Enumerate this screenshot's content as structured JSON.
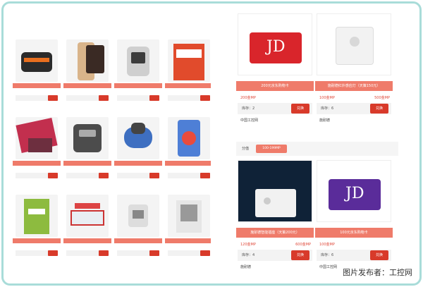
{
  "left_grid": {
    "items": [
      {
        "name": "",
        "price": "",
        "original": "",
        "stock": "",
        "button": "",
        "supplier": ""
      },
      {
        "name": "",
        "price": "",
        "original": "",
        "stock": "",
        "button": "",
        "supplier": ""
      },
      {
        "name": "",
        "price": "",
        "original": "",
        "stock": "",
        "button": "",
        "supplier": ""
      },
      {
        "name": "",
        "price": "",
        "original": "",
        "stock": "",
        "button": "",
        "supplier": ""
      },
      {
        "name": "",
        "price": "",
        "original": "",
        "stock": "",
        "button": "",
        "supplier": ""
      },
      {
        "name": "",
        "price": "",
        "original": "",
        "stock": "",
        "button": "",
        "supplier": ""
      },
      {
        "name": "",
        "price": "",
        "original": "",
        "stock": "",
        "button": "",
        "supplier": ""
      },
      {
        "name": "",
        "price": "",
        "original": "",
        "stock": "",
        "button": "",
        "supplier": ""
      },
      {
        "name": "",
        "price": "",
        "original": "",
        "stock": "",
        "button": "",
        "supplier": ""
      },
      {
        "name": "",
        "price": "",
        "original": "",
        "stock": "",
        "button": "",
        "supplier": ""
      },
      {
        "name": "",
        "price": "",
        "original": "",
        "stock": "",
        "button": "",
        "supplier": ""
      },
      {
        "name": "",
        "price": "",
        "original": "",
        "stock": "",
        "button": "",
        "supplier": ""
      }
    ]
  },
  "right_panel": {
    "top_cards": [
      {
        "name": "200元京东购物卡",
        "price": "200金MP",
        "original": "",
        "stock": "库存：2",
        "button": "兑换",
        "supplier": "中国工控网"
      },
      {
        "name": "施耐德红外感应灯（天策150元）",
        "price": "100金MP",
        "original": "500金MP",
        "stock": "库存：6",
        "button": "兑换",
        "supplier": "施耐德"
      }
    ],
    "filter": {
      "label": "分值",
      "chip": "100-199MP"
    },
    "bottom_cards": [
      {
        "name": "施耐德智能插座（天策200元）",
        "price": "120金MP",
        "original": "600金MP",
        "stock": "库存：4",
        "button": "兑换",
        "supplier": "施耐德"
      },
      {
        "name": "100元京东购物卡",
        "price": "100金MP",
        "original": "",
        "stock": "库存：6",
        "button": "兑换",
        "supplier": "中国工控网"
      }
    ]
  },
  "watermark": "图片发布者：工控网"
}
